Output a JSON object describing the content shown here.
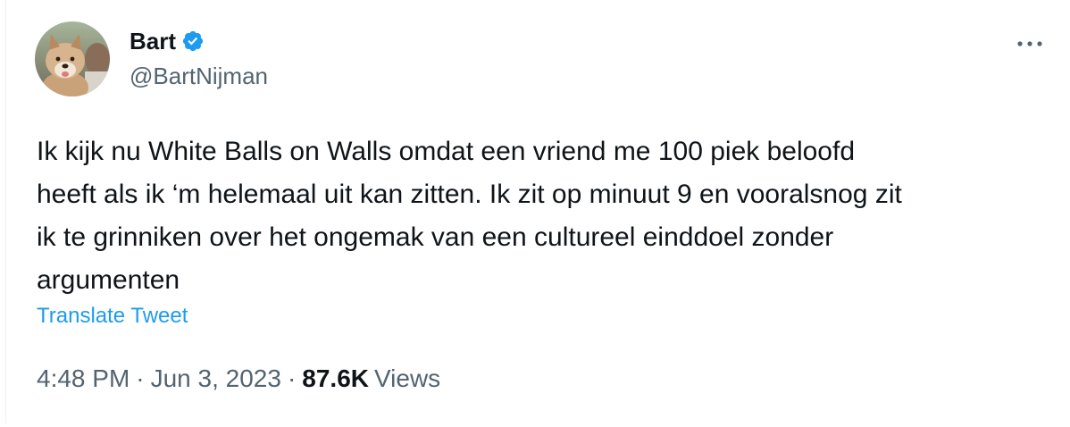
{
  "author": {
    "display_name": "Bart",
    "handle": "@BartNijman",
    "verified": true,
    "avatar_icon": "dog-avatar"
  },
  "tweet": {
    "text": "Ik kijk nu White Balls on Walls omdat een vriend me 100 piek beloofd\nheeft als ik ‘m helemaal uit kan zitten. Ik zit op minuut 9 en vooralsnog zit\nik te grinniken over het ongemak van een cultureel einddoel zonder\nargumenten",
    "translate_label": "Translate Tweet"
  },
  "meta": {
    "time": "4:48 PM",
    "separator": "·",
    "date": "Jun 3, 2023",
    "views_count": "87.6K",
    "views_label": "Views"
  },
  "colors": {
    "text_primary": "#0f1419",
    "text_secondary": "#536471",
    "accent": "#1d9bf0"
  },
  "icons": {
    "verified": "verified-badge-icon",
    "more": "more-options-icon"
  }
}
